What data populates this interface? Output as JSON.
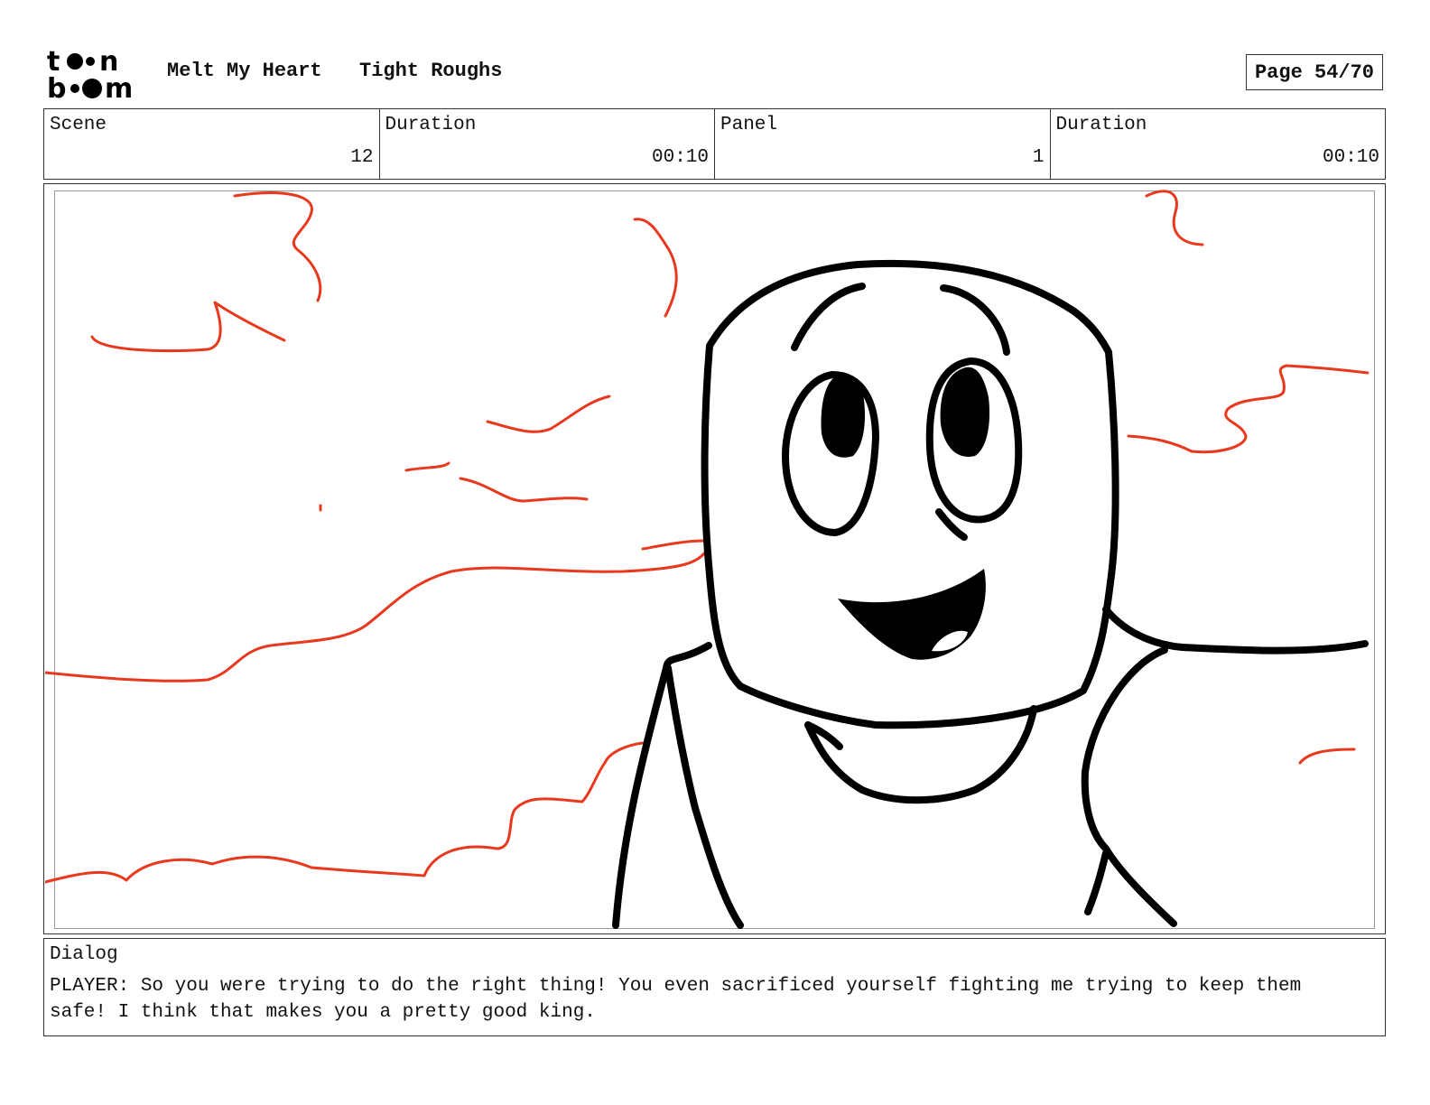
{
  "header": {
    "logo_text": "toon boom",
    "project": "Melt My Heart",
    "stage": "Tight Roughs",
    "page": "Page 54/70"
  },
  "info": {
    "scene_label": "Scene",
    "scene_value": "12",
    "scene_duration_label": "Duration",
    "scene_duration_value": "00:10",
    "panel_label": "Panel",
    "panel_value": "1",
    "panel_duration_label": "Duration",
    "panel_duration_value": "00:10"
  },
  "panel": {
    "image_icon": "storyboard-sketch-character-smiling",
    "ink_color": "#000000",
    "cloud_color": "#e8391e"
  },
  "dialog": {
    "label": "Dialog",
    "text": "PLAYER: So you were trying to do the right thing! You even sacrificed yourself fighting me trying to keep them safe! I think that makes you a pretty good king."
  }
}
